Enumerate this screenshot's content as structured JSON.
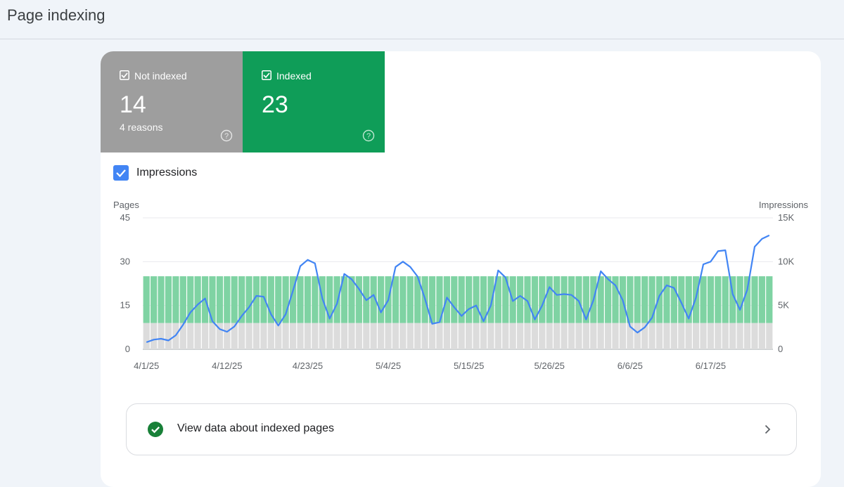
{
  "page": {
    "title": "Page indexing"
  },
  "tiles": [
    {
      "label": "Not indexed",
      "value": "14",
      "sub": "4 reasons",
      "color": "#9e9e9e"
    },
    {
      "label": "Indexed",
      "value": "23",
      "sub": "",
      "color": "#0f9d58"
    }
  ],
  "impressions_toggle": {
    "label": "Impressions",
    "checked": true
  },
  "view_link": {
    "label": "View data about indexed pages"
  },
  "icons": [
    "checkbox-icon",
    "help-icon",
    "check-circle-icon",
    "chevron-right-icon"
  ],
  "chart_data": {
    "type": "bar",
    "left_axis": {
      "label": "Pages",
      "ticks": [
        "0",
        "15",
        "30",
        "45"
      ],
      "ylim": [
        0,
        45
      ]
    },
    "right_axis": {
      "label": "Impressions",
      "ticks": [
        "0",
        "5K",
        "10K",
        "15K"
      ],
      "ylim": [
        0,
        15000
      ]
    },
    "x_tick_labels": [
      "4/1/25",
      "4/12/25",
      "4/23/25",
      "5/4/25",
      "5/15/25",
      "5/26/25",
      "6/6/25",
      "6/17/25"
    ],
    "x": [
      "4/1/25",
      "4/2/25",
      "4/3/25",
      "4/4/25",
      "4/5/25",
      "4/6/25",
      "4/7/25",
      "4/8/25",
      "4/9/25",
      "4/10/25",
      "4/11/25",
      "4/12/25",
      "4/13/25",
      "4/14/25",
      "4/15/25",
      "4/16/25",
      "4/17/25",
      "4/18/25",
      "4/19/25",
      "4/20/25",
      "4/21/25",
      "4/22/25",
      "4/23/25",
      "4/24/25",
      "4/25/25",
      "4/26/25",
      "4/27/25",
      "4/28/25",
      "4/29/25",
      "4/30/25",
      "5/1/25",
      "5/2/25",
      "5/3/25",
      "5/4/25",
      "5/5/25",
      "5/6/25",
      "5/7/25",
      "5/8/25",
      "5/9/25",
      "5/10/25",
      "5/11/25",
      "5/12/25",
      "5/13/25",
      "5/14/25",
      "5/15/25",
      "5/16/25",
      "5/17/25",
      "5/18/25",
      "5/19/25",
      "5/20/25",
      "5/21/25",
      "5/22/25",
      "5/23/25",
      "5/24/25",
      "5/25/25",
      "5/26/25",
      "5/27/25",
      "5/28/25",
      "5/29/25",
      "5/30/25",
      "5/31/25",
      "6/1/25",
      "6/2/25",
      "6/3/25",
      "6/4/25",
      "6/5/25",
      "6/6/25",
      "6/7/25",
      "6/8/25",
      "6/9/25",
      "6/10/25",
      "6/11/25",
      "6/12/25",
      "6/13/25",
      "6/14/25",
      "6/15/25",
      "6/16/25",
      "6/17/25",
      "6/18/25",
      "6/19/25",
      "6/20/25",
      "6/21/25",
      "6/22/25",
      "6/23/25",
      "6/24/25",
      "6/25/25"
    ],
    "series": [
      {
        "name": "Not indexed",
        "axis": "left",
        "color": "#dcdcdc",
        "values": [
          9,
          9,
          9,
          9,
          9,
          9,
          9,
          9,
          9,
          9,
          9,
          9,
          9,
          9,
          9,
          9,
          9,
          9,
          9,
          9,
          9,
          9,
          9,
          9,
          9,
          9,
          9,
          9,
          9,
          9,
          9,
          9,
          9,
          9,
          9,
          9,
          9,
          9,
          9,
          9,
          9,
          9,
          9,
          9,
          9,
          9,
          9,
          9,
          9,
          9,
          9,
          9,
          9,
          9,
          9,
          9,
          9,
          9,
          9,
          9,
          9,
          9,
          9,
          9,
          9,
          9,
          9,
          9,
          9,
          9,
          9,
          9,
          9,
          9,
          9,
          9,
          9,
          9,
          9,
          9,
          9,
          9,
          9,
          9,
          9,
          9
        ]
      },
      {
        "name": "Indexed",
        "axis": "left",
        "color": "#7fd3a3",
        "values": [
          16,
          16,
          16,
          16,
          16,
          16,
          16,
          16,
          16,
          16,
          16,
          16,
          16,
          16,
          16,
          16,
          16,
          16,
          16,
          16,
          16,
          16,
          16,
          16,
          16,
          16,
          16,
          16,
          16,
          16,
          16,
          16,
          16,
          16,
          16,
          16,
          16,
          16,
          16,
          16,
          16,
          16,
          16,
          16,
          16,
          16,
          16,
          16,
          16,
          16,
          16,
          16,
          16,
          16,
          16,
          16,
          16,
          16,
          16,
          16,
          16,
          16,
          16,
          16,
          16,
          16,
          16,
          16,
          16,
          16,
          16,
          16,
          16,
          16,
          16,
          16,
          16,
          16,
          16,
          16,
          16,
          16,
          16,
          16,
          16,
          16
        ]
      },
      {
        "name": "Impressions",
        "axis": "right",
        "type": "line",
        "color": "#4285f4",
        "values": [
          800,
          1100,
          1200,
          1000,
          1600,
          2800,
          4200,
          5100,
          5800,
          3200,
          2300,
          2000,
          2600,
          3800,
          4800,
          6100,
          6000,
          4000,
          2700,
          4000,
          6700,
          9500,
          10200,
          9800,
          5800,
          3500,
          5200,
          8600,
          8000,
          6900,
          5600,
          6200,
          4200,
          5600,
          9400,
          10000,
          9400,
          8300,
          5800,
          2900,
          3100,
          5900,
          4800,
          3800,
          4600,
          5000,
          3200,
          5000,
          9000,
          8200,
          5500,
          6100,
          5500,
          3400,
          5000,
          7100,
          6200,
          6300,
          6200,
          5500,
          3400,
          5600,
          8900,
          8000,
          7300,
          5600,
          2600,
          1900,
          2500,
          3600,
          6100,
          7300,
          7000,
          5300,
          3500,
          5900,
          9700,
          10000,
          11200,
          11300,
          6300,
          4500,
          6800,
          11700,
          12600,
          13000
        ]
      }
    ]
  }
}
